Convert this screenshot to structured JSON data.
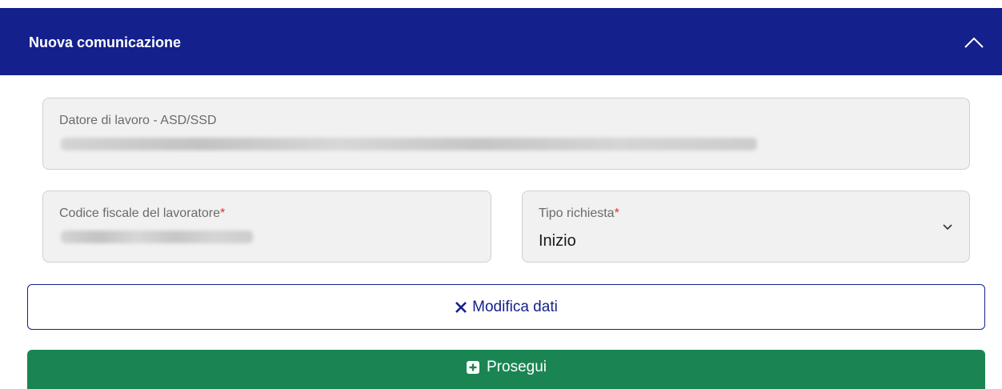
{
  "header": {
    "title": "Nuova comunicazione",
    "collapse_icon": "chevron-up-icon"
  },
  "fields": {
    "employer": {
      "label": "Datore di lavoro - ASD/SSD",
      "value_redacted": true
    },
    "tax_code": {
      "label": "Codice fiscale del lavoratore",
      "required_mark": "*",
      "value_redacted": true
    },
    "request_type": {
      "label": "Tipo richiesta",
      "required_mark": "*",
      "value": "Inizio",
      "icon": "chevron-down-icon"
    }
  },
  "buttons": {
    "modify": {
      "label": "Modifica dati",
      "icon": "close-icon"
    },
    "continue": {
      "label": "Prosegui",
      "icon": "plus-square-icon"
    }
  },
  "colors": {
    "header_bg": "#14208c",
    "primary": "#14208c",
    "success": "#1a8553",
    "required": "#d0343b",
    "field_bg": "#f1f1f1"
  }
}
